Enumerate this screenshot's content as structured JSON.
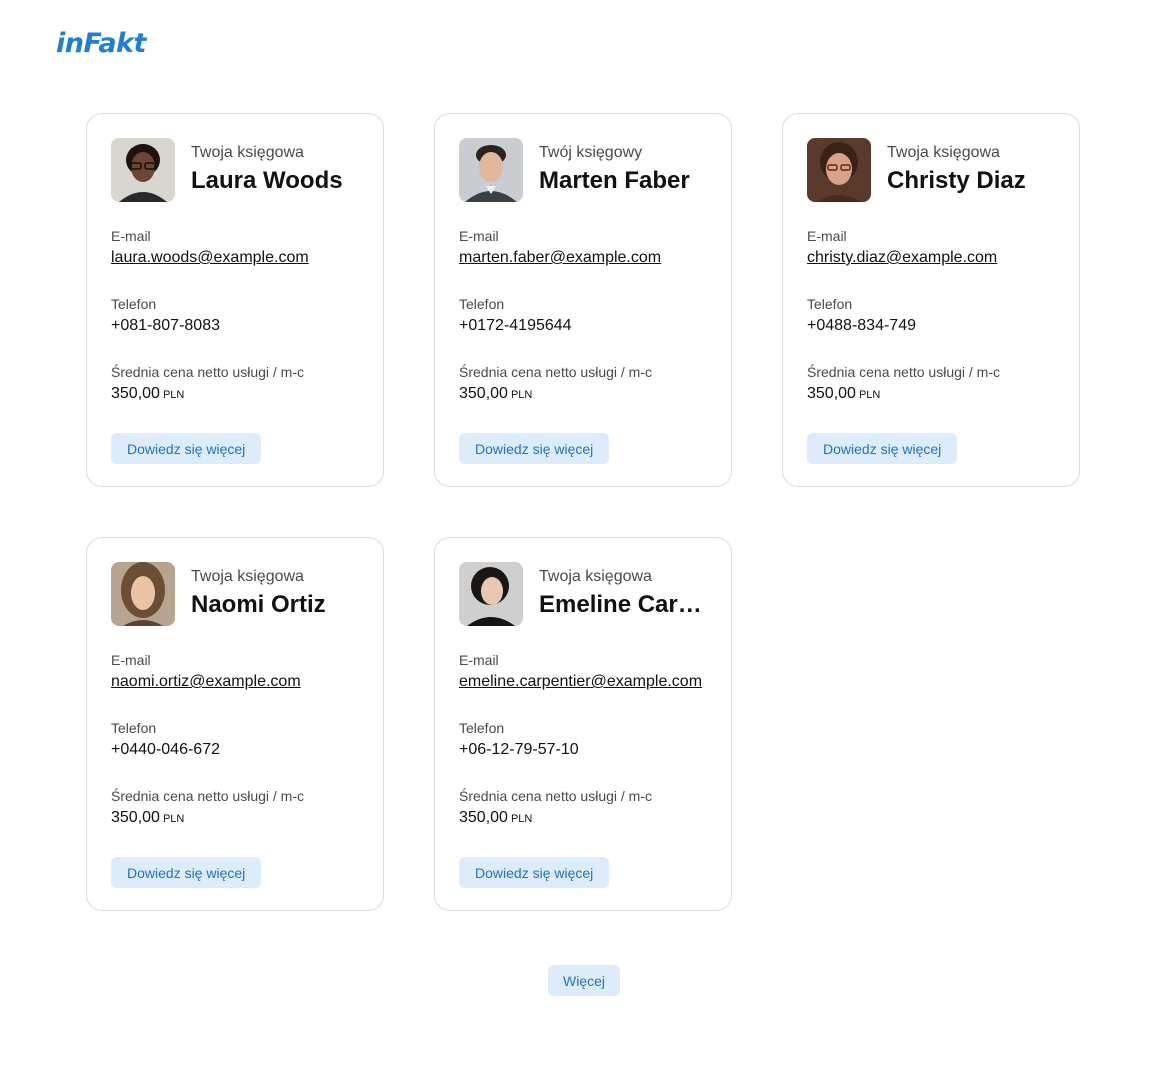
{
  "logo": "inFakt",
  "labels": {
    "email": "E-mail",
    "phone": "Telefon",
    "price": "Średnia cena netto usługi / m-c",
    "learn_more": "Dowiedz się więcej"
  },
  "accountants": [
    {
      "role": "Twoja księgowa",
      "name": "Laura Woods",
      "email": "laura.woods@example.com",
      "phone": "+081-807-8083",
      "price": "350,00",
      "currency": "PLN"
    },
    {
      "role": "Twój księgowy",
      "name": "Marten Faber",
      "email": "marten.faber@example.com",
      "phone": "+0172-4195644",
      "price": "350,00",
      "currency": "PLN"
    },
    {
      "role": "Twoja księgowa",
      "name": "Christy Diaz",
      "email": "christy.diaz@example.com",
      "phone": "+0488-834-749",
      "price": "350,00",
      "currency": "PLN"
    },
    {
      "role": "Twoja księgowa",
      "name": "Naomi Ortiz",
      "email": "naomi.ortiz@example.com",
      "phone": "+0440-046-672",
      "price": "350,00",
      "currency": "PLN"
    },
    {
      "role": "Twoja księgowa",
      "name": "Emeline Carpentier",
      "email": "emeline.carpentier@example.com",
      "phone": "+06-12-79-57-10",
      "price": "350,00",
      "currency": "PLN"
    }
  ],
  "more_label": "Więcej"
}
